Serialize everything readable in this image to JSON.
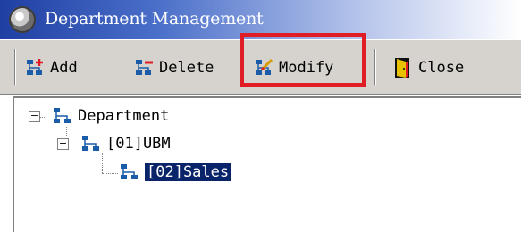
{
  "window": {
    "title": "Department Management",
    "icon": "app-globe-icon"
  },
  "toolbar": {
    "add_label": "Add",
    "delete_label": "Delete",
    "modify_label": "Modify",
    "close_label": "Close",
    "highlighted_button": "Modify",
    "highlight_color": "#e01c24"
  },
  "tree": {
    "root": {
      "label": "Department",
      "expanded": true
    },
    "child": {
      "label": "[01]UBM",
      "expanded": true
    },
    "leaf": {
      "label": "[02]Sales",
      "selected": true
    }
  },
  "colors": {
    "titlebar_start": "#1f3fa3",
    "selection": "#0a246a",
    "toolbar_bg": "#d6d3ce"
  }
}
